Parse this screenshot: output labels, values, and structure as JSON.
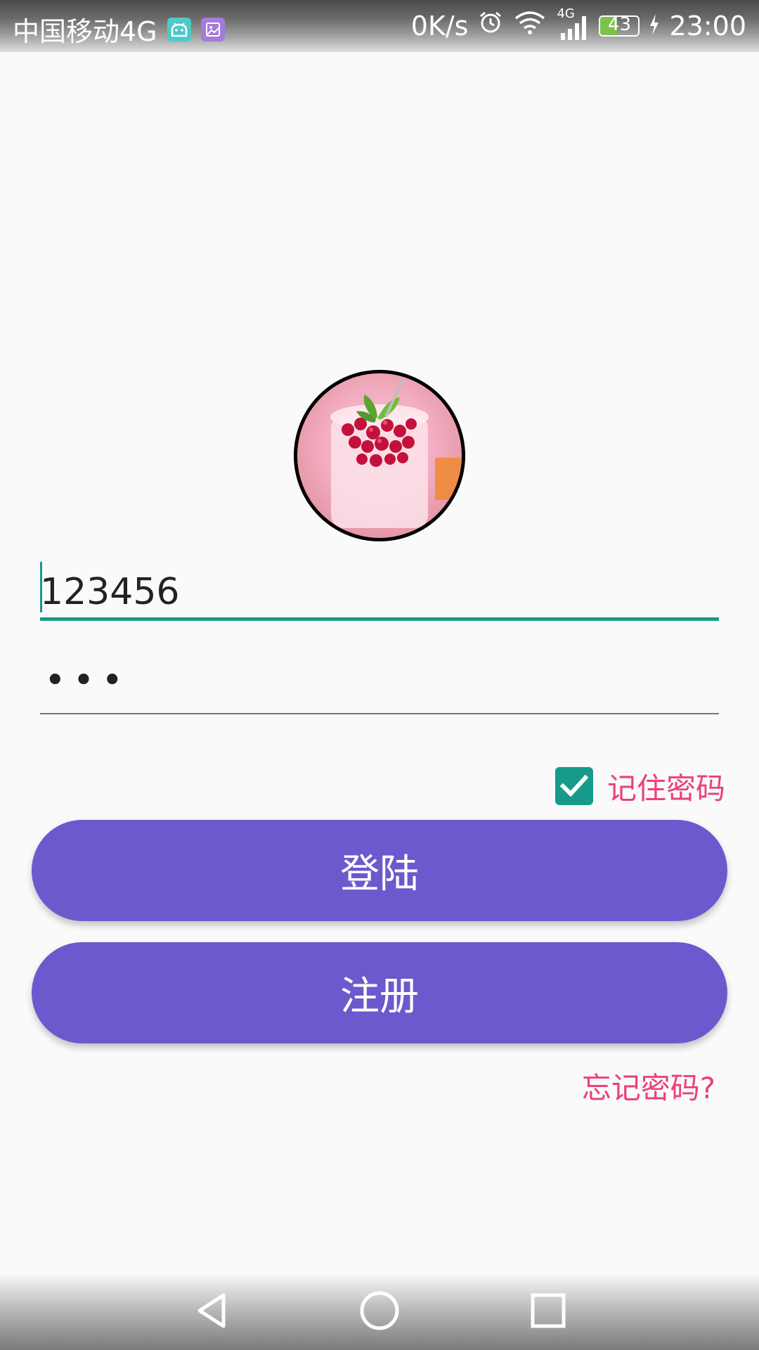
{
  "status_bar": {
    "carrier": "中国移动4G",
    "net_speed": "0K/s",
    "network_type": "4G",
    "battery_level": "43",
    "battery_fraction": 0.43,
    "time": "23:00",
    "icons": [
      "android-debug-icon",
      "gallery-icon",
      "alarm-icon",
      "wifi-icon",
      "signal-icon",
      "battery-icon",
      "charging-icon"
    ]
  },
  "login": {
    "avatar_icon": "avatar-image",
    "username_value": "123456",
    "password_mask": "•••",
    "remember_label": "记住密码",
    "remember_checked": true,
    "login_label": "登陆",
    "register_label": "注册",
    "forgot_label": "忘记密码?"
  },
  "colors": {
    "accent": "#1a9a8a",
    "button": "#6a5acd",
    "link": "#ec407a"
  },
  "nav_bar": {
    "icons": [
      "back-icon",
      "home-icon",
      "recent-apps-icon"
    ]
  }
}
